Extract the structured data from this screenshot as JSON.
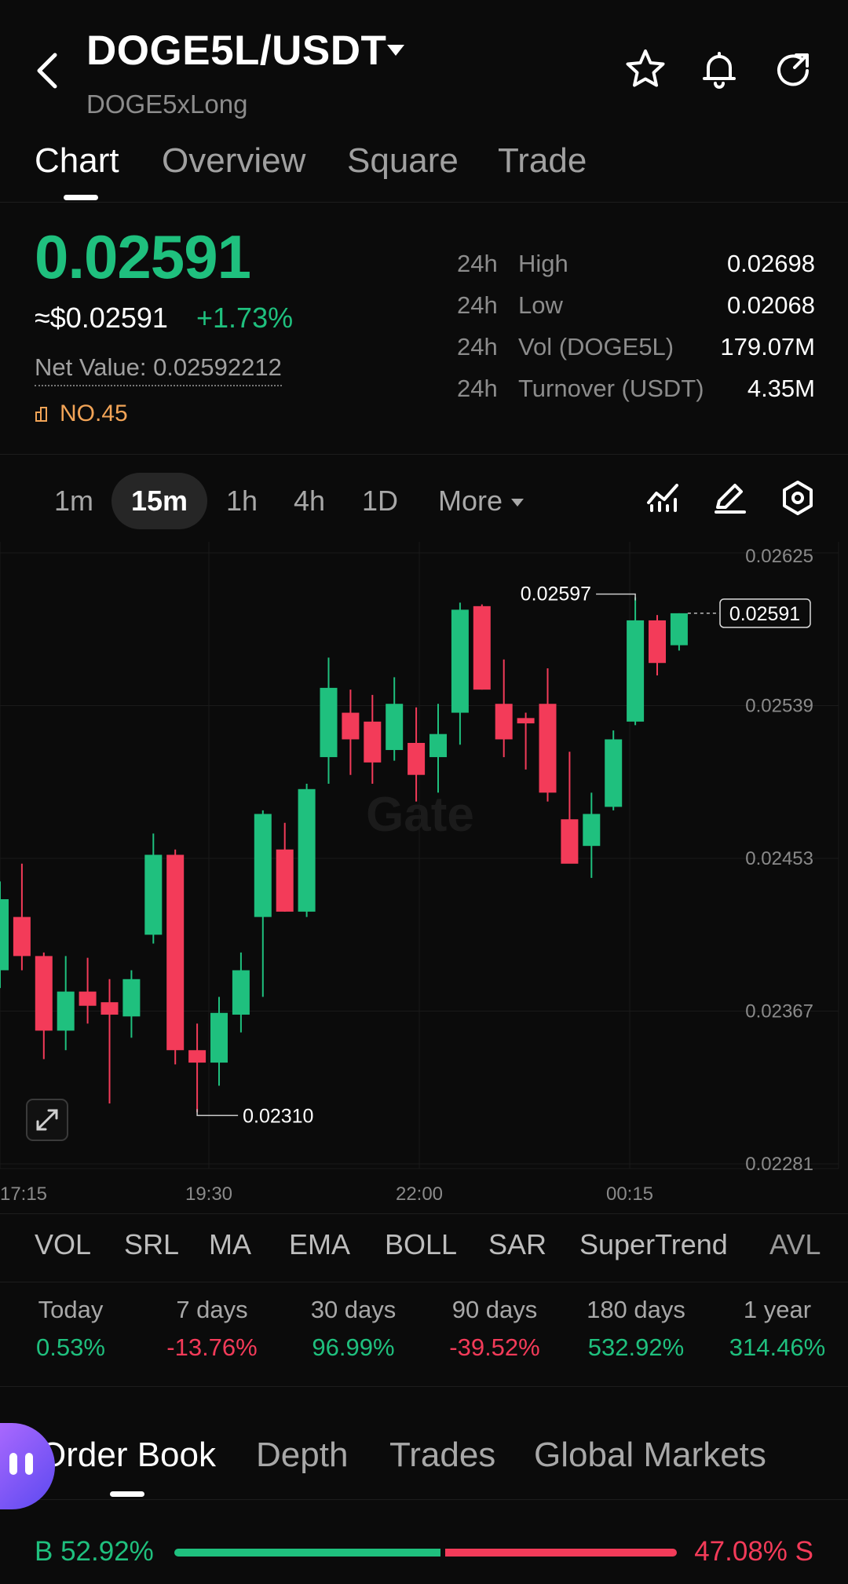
{
  "header": {
    "pair": "DOGE5L/USDT",
    "subtitle": "DOGE5xLong"
  },
  "tabs": [
    {
      "label": "Chart"
    },
    {
      "label": "Overview"
    },
    {
      "label": "Square"
    },
    {
      "label": "Trade"
    }
  ],
  "price": {
    "last": "0.02591",
    "usd": "≈$0.02591",
    "change": "+1.73%",
    "net_value": "Net Value: 0.02592212",
    "rank": "NO.45"
  },
  "stats": [
    {
      "period": "24h",
      "label": "High",
      "value": "0.02698"
    },
    {
      "period": "24h",
      "label": "Low",
      "value": "0.02068"
    },
    {
      "period": "24h",
      "label": "Vol (DOGE5L)",
      "value": "179.07M"
    },
    {
      "period": "24h",
      "label": "Turnover (USDT)",
      "value": "4.35M"
    }
  ],
  "intervals": {
    "items": [
      "1m",
      "15m",
      "1h",
      "4h",
      "1D"
    ],
    "selected": "15m",
    "more_label": "More"
  },
  "chart_data": {
    "type": "candlestick",
    "y_ticks": [
      "0.02625",
      "0.02539",
      "0.02453",
      "0.02367",
      "0.02281"
    ],
    "ylim": [
      0.02281,
      0.02625
    ],
    "x_ticks": [
      "17:15",
      "19:30",
      "22:00",
      "00:15"
    ],
    "last_price_label": "0.02591",
    "high_marker": "0.02597",
    "low_marker": "0.02310",
    "watermark": "Gate",
    "candles": [
      {
        "o": 0.0239,
        "h": 0.0244,
        "l": 0.0238,
        "c": 0.0243
      },
      {
        "o": 0.0242,
        "h": 0.0245,
        "l": 0.0239,
        "c": 0.02398
      },
      {
        "o": 0.02398,
        "h": 0.024,
        "l": 0.0234,
        "c": 0.02356
      },
      {
        "o": 0.02356,
        "h": 0.02398,
        "l": 0.02345,
        "c": 0.02378
      },
      {
        "o": 0.02378,
        "h": 0.02397,
        "l": 0.0236,
        "c": 0.0237
      },
      {
        "o": 0.02372,
        "h": 0.02385,
        "l": 0.02315,
        "c": 0.02365
      },
      {
        "o": 0.02364,
        "h": 0.0239,
        "l": 0.02352,
        "c": 0.02385
      },
      {
        "o": 0.0241,
        "h": 0.02467,
        "l": 0.02405,
        "c": 0.02455
      },
      {
        "o": 0.02455,
        "h": 0.02458,
        "l": 0.02337,
        "c": 0.02345
      },
      {
        "o": 0.02345,
        "h": 0.0236,
        "l": 0.0231,
        "c": 0.02338
      },
      {
        "o": 0.02338,
        "h": 0.02375,
        "l": 0.02325,
        "c": 0.02366
      },
      {
        "o": 0.02365,
        "h": 0.024,
        "l": 0.02355,
        "c": 0.0239
      },
      {
        "o": 0.0242,
        "h": 0.0248,
        "l": 0.02375,
        "c": 0.02478
      },
      {
        "o": 0.02458,
        "h": 0.02473,
        "l": 0.02423,
        "c": 0.02423
      },
      {
        "o": 0.02423,
        "h": 0.02495,
        "l": 0.0242,
        "c": 0.02492
      },
      {
        "o": 0.0251,
        "h": 0.02566,
        "l": 0.02495,
        "c": 0.02549
      },
      {
        "o": 0.02535,
        "h": 0.02548,
        "l": 0.025,
        "c": 0.0252
      },
      {
        "o": 0.0253,
        "h": 0.02545,
        "l": 0.02495,
        "c": 0.02507
      },
      {
        "o": 0.02514,
        "h": 0.02555,
        "l": 0.02508,
        "c": 0.0254
      },
      {
        "o": 0.02518,
        "h": 0.02538,
        "l": 0.02485,
        "c": 0.025
      },
      {
        "o": 0.0251,
        "h": 0.0254,
        "l": 0.0249,
        "c": 0.02523
      },
      {
        "o": 0.02535,
        "h": 0.02597,
        "l": 0.02517,
        "c": 0.02593
      },
      {
        "o": 0.02595,
        "h": 0.02596,
        "l": 0.02548,
        "c": 0.02548
      },
      {
        "o": 0.0254,
        "h": 0.02565,
        "l": 0.0251,
        "c": 0.0252
      },
      {
        "o": 0.02532,
        "h": 0.02535,
        "l": 0.02503,
        "c": 0.02529
      },
      {
        "o": 0.0254,
        "h": 0.0256,
        "l": 0.02485,
        "c": 0.0249
      },
      {
        "o": 0.02475,
        "h": 0.02513,
        "l": 0.0246,
        "c": 0.0245
      },
      {
        "o": 0.0246,
        "h": 0.0249,
        "l": 0.02442,
        "c": 0.02478
      },
      {
        "o": 0.02482,
        "h": 0.02525,
        "l": 0.0248,
        "c": 0.0252
      },
      {
        "o": 0.0253,
        "h": 0.026,
        "l": 0.02528,
        "c": 0.02587
      },
      {
        "o": 0.02587,
        "h": 0.0259,
        "l": 0.02556,
        "c": 0.02563
      },
      {
        "o": 0.02573,
        "h": 0.02591,
        "l": 0.0257,
        "c": 0.02591
      }
    ]
  },
  "indicators": [
    "VOL",
    "SRL",
    "MA",
    "EMA",
    "BOLL",
    "SAR",
    "SuperTrend",
    "AVL"
  ],
  "performance": [
    {
      "label": "Today",
      "value": "0.53%",
      "color": "#1fc07e"
    },
    {
      "label": "7 days",
      "value": "-13.76%",
      "color": "#f33b59"
    },
    {
      "label": "30 days",
      "value": "96.99%",
      "color": "#1fc07e"
    },
    {
      "label": "90 days",
      "value": "-39.52%",
      "color": "#f33b59"
    },
    {
      "label": "180 days",
      "value": "532.92%",
      "color": "#1fc07e"
    },
    {
      "label": "1 year",
      "value": "314.46%",
      "color": "#1fc07e"
    }
  ],
  "bottom_tabs": [
    {
      "label": "Order Book"
    },
    {
      "label": "Depth"
    },
    {
      "label": "Trades"
    },
    {
      "label": "Global Markets"
    }
  ],
  "book_ratio": {
    "buy_label": "B 52.92%",
    "sell_label": "47.08% S",
    "buy_fraction": 0.5292
  },
  "colors": {
    "up": "#1fc07e",
    "down": "#f33b59",
    "background": "#0b0b0b"
  }
}
